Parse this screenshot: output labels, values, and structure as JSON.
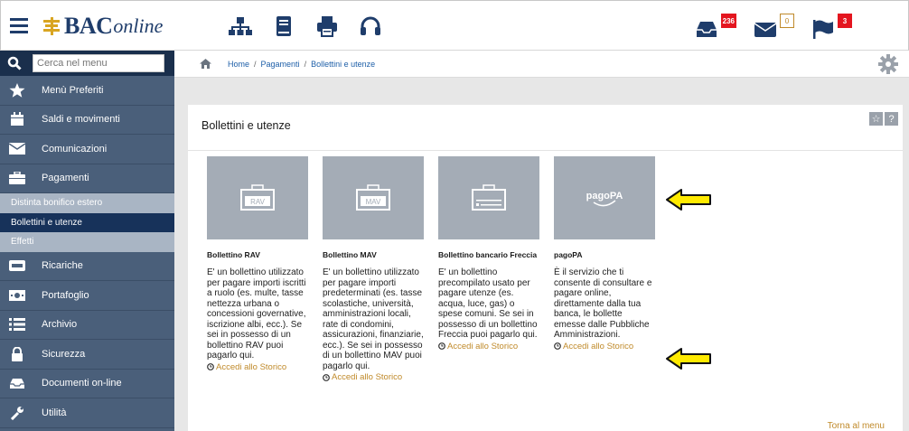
{
  "header": {
    "logo_brand": "BAC",
    "logo_suffix": "online",
    "badges": {
      "inbox_count": "236",
      "mail_count": "0",
      "flag_count": "3"
    }
  },
  "sidebar": {
    "search_placeholder": "Cerca nel menu",
    "items": [
      {
        "label": "Menù Preferiti",
        "icon": "star-icon"
      },
      {
        "label": "Saldi e movimenti",
        "icon": "calendar-icon"
      },
      {
        "label": "Comunicazioni",
        "icon": "envelope-icon"
      },
      {
        "label": "Pagamenti",
        "icon": "briefcase-icon"
      }
    ],
    "sub_items": [
      {
        "label": "Distinta bonifico estero"
      },
      {
        "label": "Bollettini e utenze"
      },
      {
        "label": "Effetti"
      }
    ],
    "items_after": [
      {
        "label": "Ricariche",
        "icon": "card-icon"
      },
      {
        "label": "Portafoglio",
        "icon": "banknote-icon"
      },
      {
        "label": "Archivio",
        "icon": "list-icon"
      },
      {
        "label": "Sicurezza",
        "icon": "lock-icon"
      },
      {
        "label": "Documenti on-line",
        "icon": "tray-icon"
      },
      {
        "label": "Utilità",
        "icon": "wrench-icon"
      }
    ]
  },
  "breadcrumb": {
    "home": "Home",
    "level1": "Pagamenti",
    "current": "Bollettini e utenze",
    "separator": "/"
  },
  "panel": {
    "title": "Bollettini e utenze",
    "tool_star": "☆",
    "tool_help": "?"
  },
  "cards": [
    {
      "image_label": "RAV",
      "title": "Bollettino RAV",
      "desc": "E' un bollettino utilizzato per pagare importi iscritti a ruolo (es. multe, tasse nettezza urbana o concessioni governative, iscrizione albi, ecc.). Se sei in possesso di un bollettino RAV puoi pagarlo qui.",
      "link": "Accedi allo Storico"
    },
    {
      "image_label": "MAV",
      "title": "Bollettino MAV",
      "desc": "E' un bollettino utilizzato per pagare importi predeterminati (es. tasse scolastiche, università, amministrazioni locali, rate di condomini, assicurazioni, finanziarie, ecc.). Se sei in possesso di un bollettino MAV puoi pagarlo qui.",
      "link": "Accedi allo Storico"
    },
    {
      "image_label": "",
      "title": "Bollettino bancario Freccia",
      "desc": "E' un bollettino precompilato usato per pagare utenze (es. acqua, luce, gas) o spese comuni. Se sei in possesso di un bollettino Freccia puoi pagarlo qui.",
      "link": "Accedi allo Storico"
    },
    {
      "image_label": "pagoPA",
      "title": "pagoPA",
      "desc": "È il servizio che ti consente di consultare e pagare online, direttamente dalla tua banca, le bollette emesse dalle Pubbliche Amministrazioni.",
      "link": "Accedi allo Storico"
    }
  ],
  "footer_link": "Torna al menu",
  "colors": {
    "brand_navy": "#1f3d6b",
    "sidebar_bg": "#4a5f7a",
    "accent_gold": "#c08a2a",
    "badge_red": "#e4151f",
    "annotation_arrow": "#ffea00"
  }
}
